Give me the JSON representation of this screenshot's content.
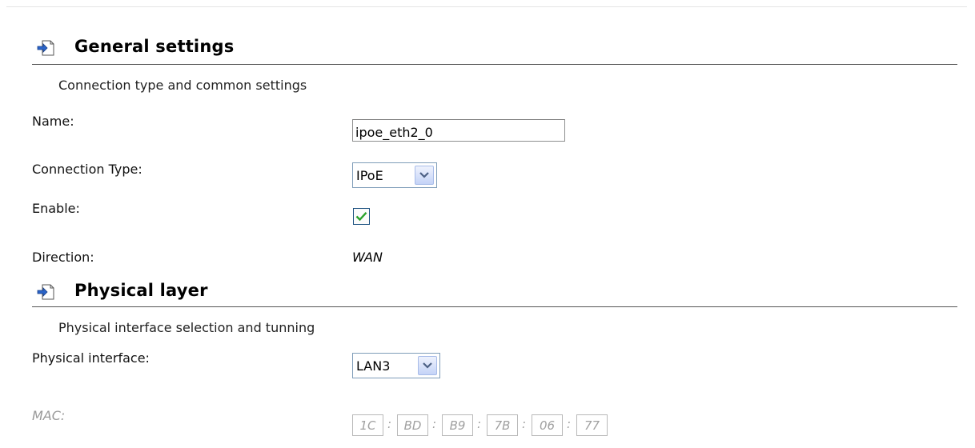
{
  "general": {
    "title": "General settings",
    "description": "Connection type and common settings",
    "name_label": "Name:",
    "name_value": "ipoe_eth2_0",
    "conn_type_label": "Connection Type:",
    "conn_type_value": "IPoE",
    "enable_label": "Enable:",
    "enable_checked": true,
    "direction_label": "Direction:",
    "direction_value": "WAN"
  },
  "physical": {
    "title": "Physical layer",
    "description": "Physical interface selection and tunning",
    "interface_label": "Physical interface:",
    "interface_value": "LAN3",
    "mac_label": "MAC:",
    "mac": [
      "1C",
      "BD",
      "B9",
      "7B",
      "06",
      "77"
    ],
    "mac_separator": ":"
  },
  "icons": {
    "section": "page-arrow-icon",
    "dropdown": "chevron-down-icon",
    "check": "checkmark-icon"
  },
  "colors": {
    "rule": "#555555",
    "disabled_text": "#999999",
    "check": "#2aa12a",
    "select_border": "#7f9db9"
  }
}
